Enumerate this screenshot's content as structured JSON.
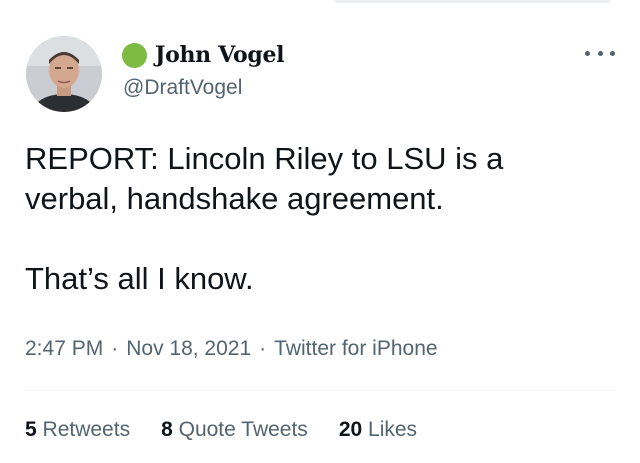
{
  "user": {
    "display_name": "John Vogel",
    "handle": "@DraftVogel"
  },
  "tweet": {
    "lines": [
      "REPORT: Lincoln Riley to LSU is a",
      "verbal, handshake agreement.",
      "That’s all I know."
    ]
  },
  "meta": {
    "time": "2:47 PM",
    "date": "Nov 18, 2021",
    "source": "Twitter for iPhone",
    "separator": "·"
  },
  "stats": {
    "retweets_count": "5",
    "retweets_label": "Retweets",
    "quotes_count": "8",
    "quotes_label": "Quote Tweets",
    "likes_count": "20",
    "likes_label": "Likes"
  },
  "icons": {
    "status": "green-dot-icon",
    "more": "more-horizontal-icon"
  },
  "colors": {
    "text": "#0f1419",
    "secondary": "#536471",
    "status_dot": "#7dbb42",
    "divider": "#eff3f4"
  }
}
